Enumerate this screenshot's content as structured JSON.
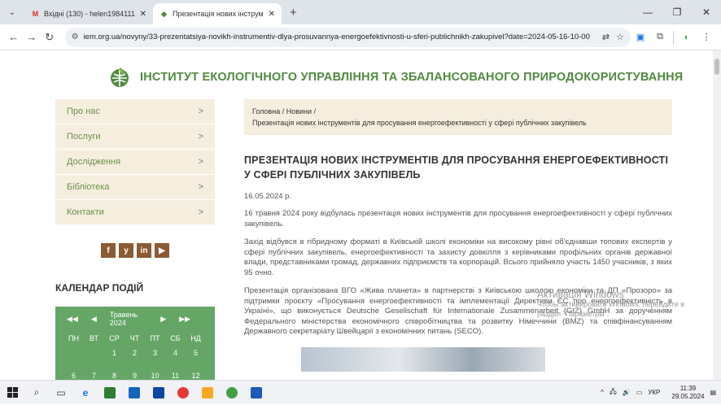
{
  "browser": {
    "tabs": [
      {
        "title": "Вхідні (130) - helen1984111@",
        "favicon": "gmail-icon",
        "active": false
      },
      {
        "title": "Презентація нових інструмен",
        "favicon": "site-icon",
        "active": true
      }
    ],
    "new_tab": "+",
    "url": "iem.org.ua/novyny/33-prezentatsiya-novikh-instrumentiv-dlya-prosuvannya-energoefektivnosti-u-sferi-publichnikh-zakupivel?date=2024-05-16-10-00"
  },
  "site": {
    "title": "ІНСТИТУТ ЕКОЛОГІЧНОГО УПРАВЛІННЯ ТА ЗБАЛАНСОВАНОГО ПРИРОДОКОРИСТУВАННЯ",
    "accent": "#4f8a3f"
  },
  "sidebar": {
    "items": [
      {
        "label": "Про нас"
      },
      {
        "label": "Послуги"
      },
      {
        "label": "Дослідження"
      },
      {
        "label": "Бібліотека"
      },
      {
        "label": "Контакти"
      }
    ],
    "social": [
      "f",
      "y",
      "in",
      "▶"
    ],
    "calendar_heading": "КАЛЕНДАР ПОДІЙ",
    "calendar": {
      "month": "Травень 2024",
      "weekdays": [
        "ПН",
        "ВТ",
        "СР",
        "ЧТ",
        "ПТ",
        "СБ",
        "НД"
      ],
      "week1": [
        "",
        "",
        "1",
        "2",
        "3",
        "4",
        "5"
      ],
      "week2": [
        "6",
        "7",
        "8",
        "9",
        "10",
        "11",
        "12"
      ]
    }
  },
  "content": {
    "breadcrumb_line1": "Головна / Новини /",
    "breadcrumb_line2": "Презентація нових інструментів для просування енергоефективності у сфері публічних закупівель",
    "title": "ПРЕЗЕНТАЦІЯ НОВИХ ІНСТРУМЕНТІВ ДЛЯ ПРОСУВАННЯ ЕНЕРГОЕФЕКТИВНОСТІ У СФЕРІ ПУБЛІЧНИХ ЗАКУПІВЕЛЬ",
    "date": "16.05.2024 р.",
    "p1": "16 травня 2024 року відбулась презентація нових інструментів для просування енергоефективності у сфері публічних закупівель.",
    "p2": "Захід відбувся в гібридному форматі в Київській школі економіки на високому рівні об'єднавши топових експертів у сфері публічних закупівель, енергоефективності та захисту довкілля з керівниками профільних органів державної влади, представниками громад, державних підприємств та корпорацій. Всього прийняло участь 1450 учасників, з яких 95 очно.",
    "p3": "Презентація організована ВГО «Жива планета» в партнерстві з Київською школою економіки та ДП «Прозоро» за підтримки проєкту «Просування енергоефективності та імплементації Директиви ЄС про енергоефективність в Україні», що виконується Deutsche Gesellschaft für Internationale Zusammenarbeit (GIZ) GmbH за дорученням Федерального міністерства економічного співробітництва та розвитку Німеччини (BMZ) та співфінансуванням Державного секретаріату Швейцарії з економічних питань (SECO)."
  },
  "watermark": {
    "line1": "Активація Windows",
    "line2": "Чтобы активировать Windows, перейдите в",
    "line3": "раздел \"Параметры\"."
  },
  "taskbar": {
    "lang": "УКР",
    "time": "11:39",
    "date": "29.05.2024"
  }
}
